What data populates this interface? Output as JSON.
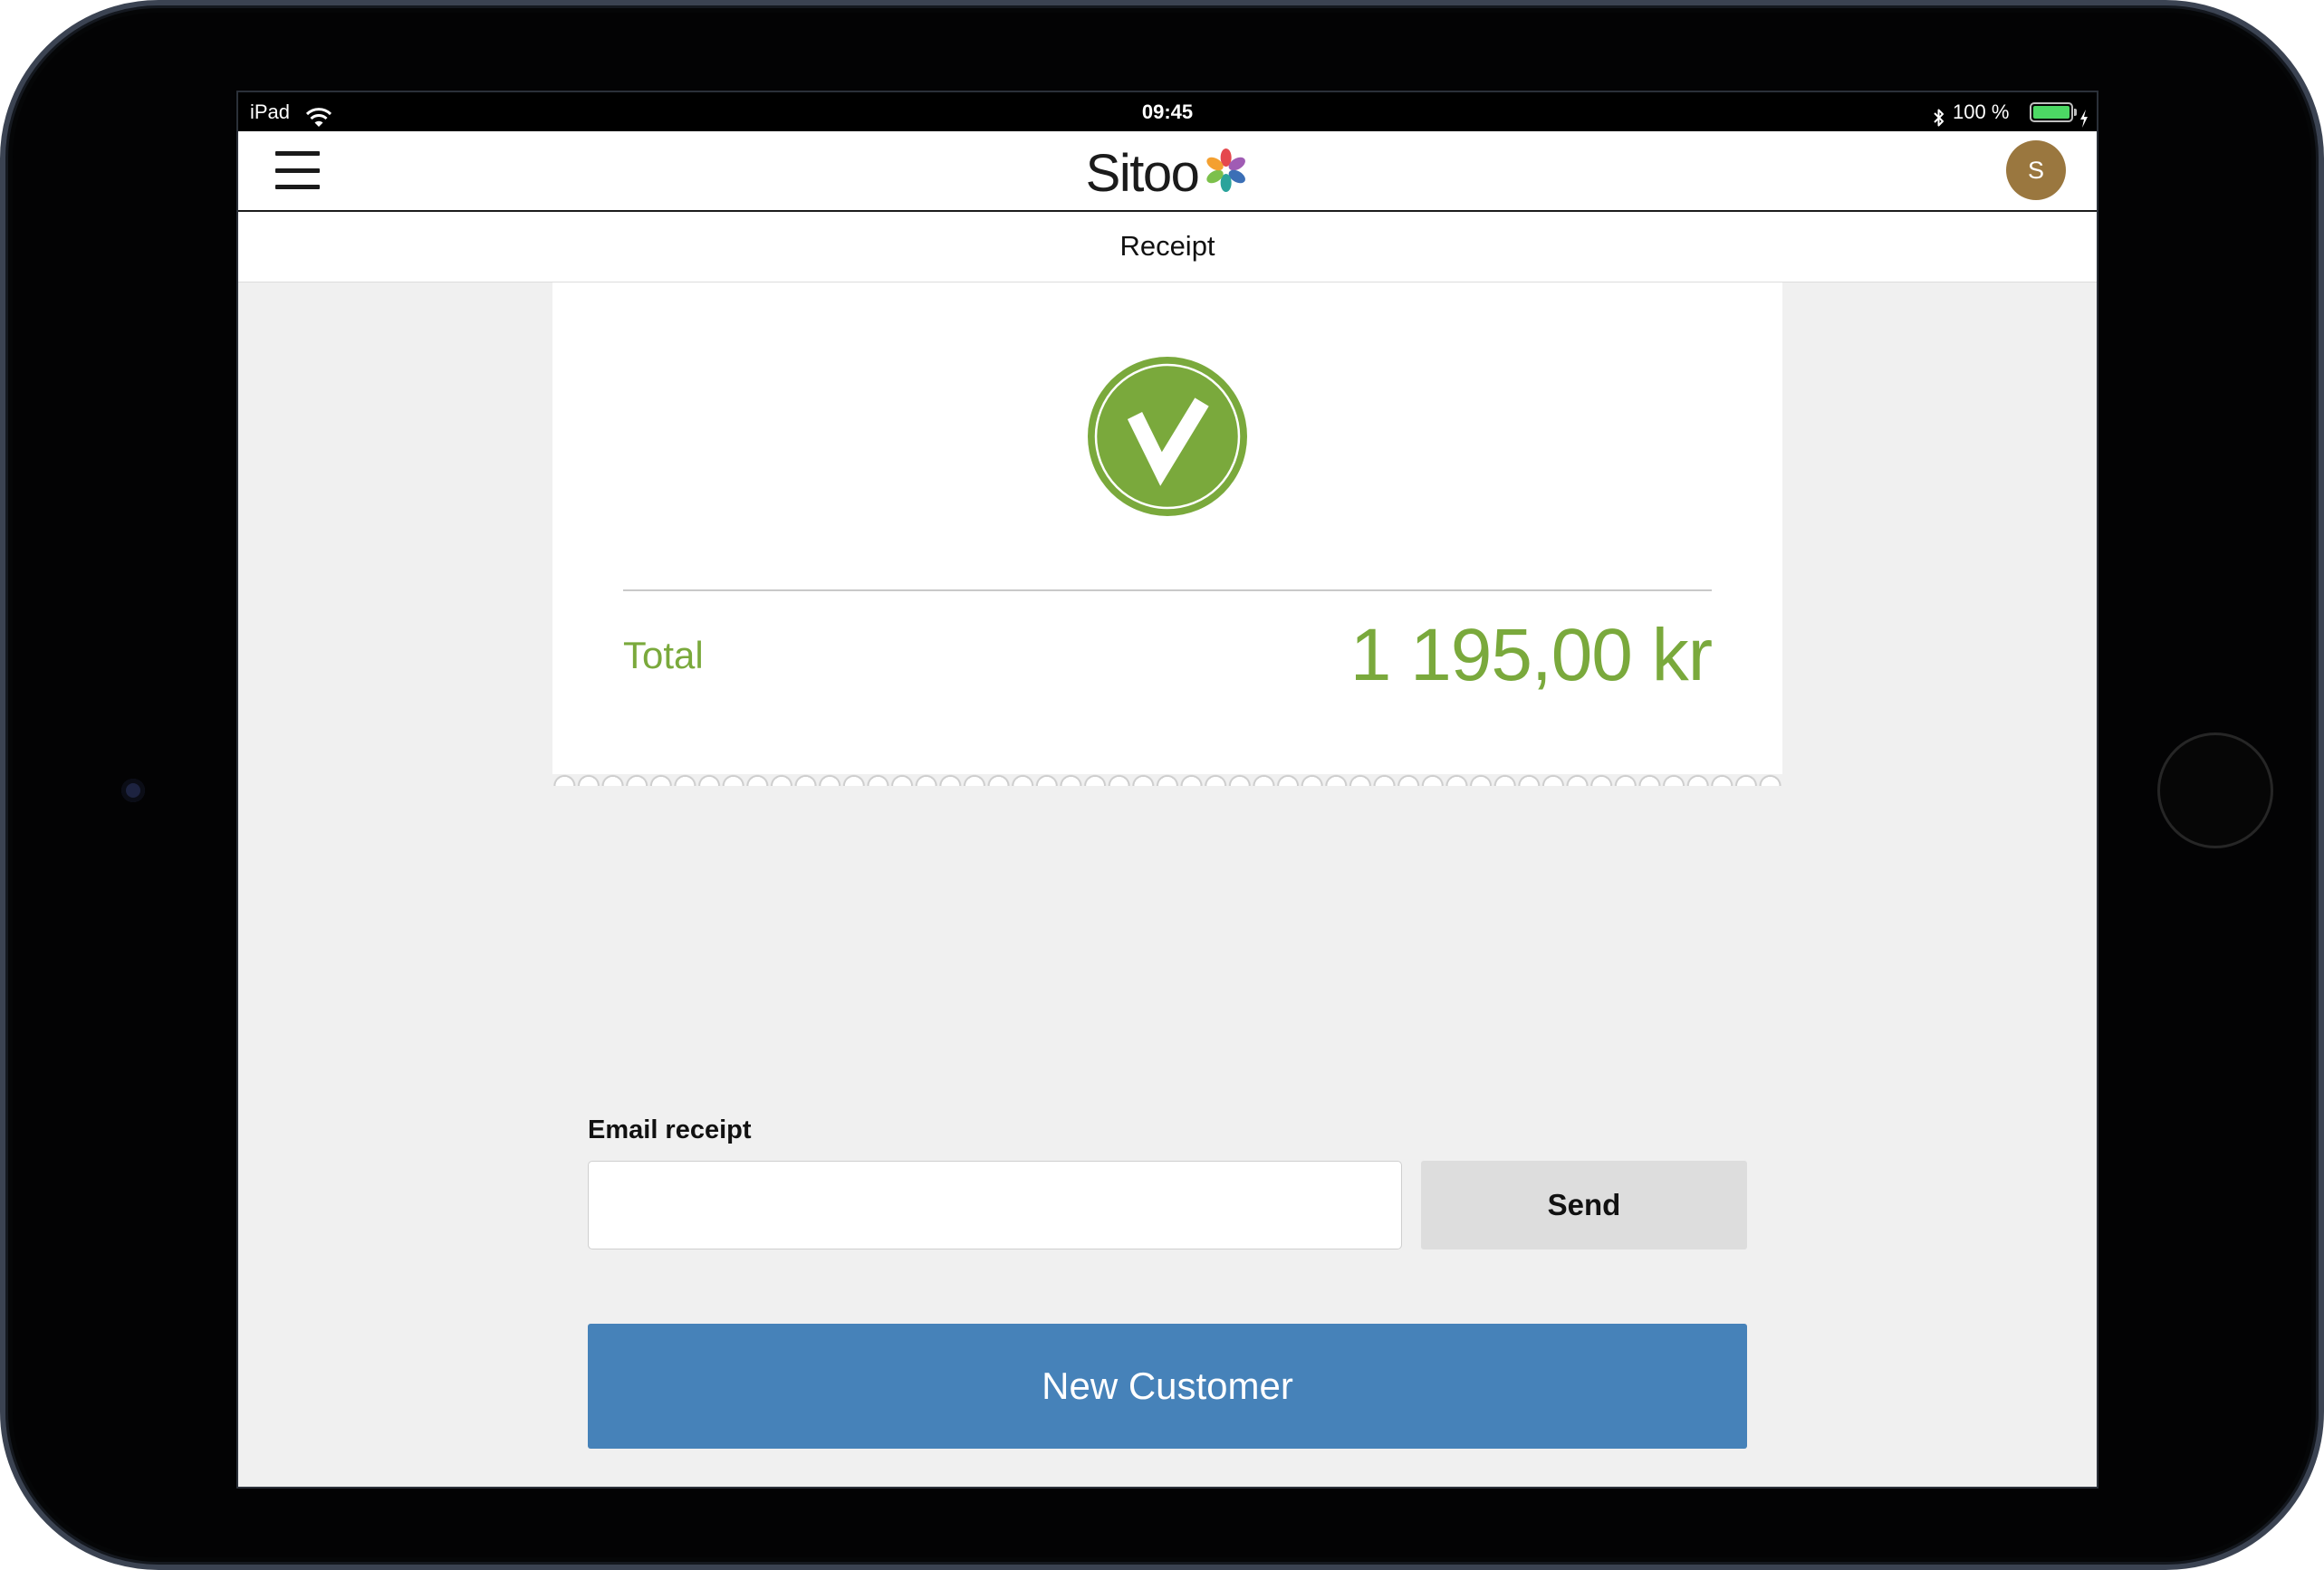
{
  "status_bar": {
    "device": "iPad",
    "time": "09:45",
    "battery": "100 %",
    "battery_level": 1.0
  },
  "header": {
    "logo_text": "Sitoo",
    "logo_petal_colors": [
      "#e5484d",
      "#a05cb4",
      "#3b6fb6",
      "#2aa39b",
      "#7cc04b",
      "#f4a030"
    ],
    "avatar_initial": "S"
  },
  "page_title": "Receipt",
  "receipt": {
    "total_label": "Total",
    "total_value": "1 195,00 kr"
  },
  "email": {
    "label": "Email receipt",
    "value": "",
    "send_label": "Send"
  },
  "actions": {
    "new_customer_label": "New Customer"
  },
  "colors": {
    "accent_green": "#7aa93c",
    "primary_blue": "#4682b9",
    "avatar": "#9a773f",
    "battery": "#4cd964"
  },
  "icons": [
    "wifi-icon",
    "bluetooth-icon",
    "battery-icon",
    "charging-icon",
    "menu-icon",
    "check-icon"
  ]
}
